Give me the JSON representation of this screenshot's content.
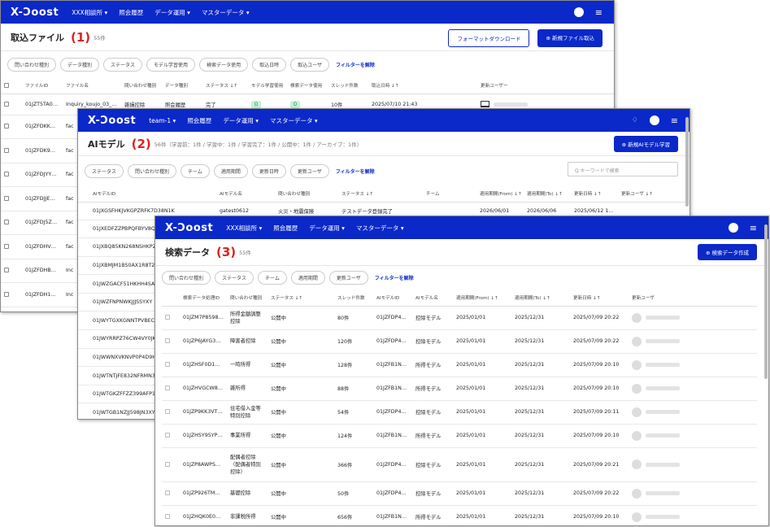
{
  "w1": {
    "logo": "X-Ɔoost",
    "nav": [
      "XXX相談所 ▾",
      "照会履歴",
      "データ運用 ▾",
      "マスターデータ ▾"
    ],
    "title": "取込ファイル",
    "num": "(1)",
    "count": "55件",
    "btn_dl": "フォーマットダウンロード",
    "btn_new": "⊕ 新規ファイル取込",
    "filters": [
      "問い合わせ種別",
      "データ種別",
      "ステータス",
      "モデル学習使用",
      "検索データ使用",
      "取込日時",
      "取込ユーザ"
    ],
    "clear": "フィルターを解除",
    "cols": [
      "",
      "ファイルID",
      "ファイル名",
      "問い合わせ種別",
      "データ種別",
      "ステータス ↓↑",
      "モデル学習使用",
      "検索データ使用",
      "スレッド件数",
      "取込日時 ↓↑",
      "更新ユーザー"
    ],
    "row": {
      "id": "01JZT5TA0…",
      "name": "Inquiry_koujo_03_…",
      "type": "雑損控除",
      "dtype": "照会履歴",
      "status": "完了",
      "m": "O",
      "s": "O",
      "cnt": "10件",
      "date": "2025/07/10 21:43"
    },
    "ids": [
      "01JZFDKK…",
      "01JZFDK9…",
      "01JZFDJYY…",
      "01JZFDJJE…",
      "01JZFDJ5Z…",
      "01JZFDHV…",
      "01JZFDHB…",
      "01JZFDH1…"
    ],
    "names": [
      "fac",
      "fac",
      "fac",
      "fac",
      "fac",
      "fac",
      "Inc",
      "Inc"
    ]
  },
  "w2": {
    "logo": "X-Ɔoost",
    "nav": [
      "team-1 ▾",
      "照会履歴",
      "データ運用 ▾",
      "マスターデータ ▾"
    ],
    "bell": "♢",
    "title": "AIモデル",
    "num": "(2)",
    "count": "56件（学習前：1件 / 学習中：1件 / 学習完了：1件 / 公開中：1件 / アーカイブ：1件）",
    "btn_new": "⊕ 新規AIモデル学習",
    "filters": [
      "ステータス",
      "問い合わせ種別",
      "チーム",
      "適用期間",
      "更新日時",
      "更新ユーザ"
    ],
    "clear": "フィルターを解除",
    "search": "Q キーワードで検索",
    "cols": [
      "AIモデルID",
      "AIモデル名",
      "問い合わせ種別",
      "ステータス ↓↑",
      "チーム",
      "適用期間(From) ↓↑",
      "適用期間(To) ↓↑",
      "更新日時 ↓↑",
      "更新ユーザ ↓↑"
    ],
    "row": {
      "id": "01JXGSFHKJVKGPZRFK7D38N1K",
      "name": "gatest0612",
      "type": "火災・地震保険",
      "status": "テストデータ登録完了",
      "from": "2026/06/01",
      "to": "2026/06/06",
      "upd": "2025/06/12 10:04"
    },
    "ids": [
      "01JXEDFZZPBPQFBYV8Q",
      "01JXBQ85KN268NSHKPZ",
      "01JXBMJM1BS0AX1R8T2",
      "01JWZGACF51HKHH4SAY",
      "01JWZFNPNWKJJJSSYXY",
      "01JWYTGXKGNNTPVBECD",
      "01JWYRRPZ76CW4VY0JK",
      "01JWWNXVKNVP0P4D9H",
      "01JWTNTJFE832NFRMN3",
      "01JWTGKZFFZZ399AFP1E",
      "01JWTGB1NZJJ598JN3XY"
    ]
  },
  "w3": {
    "logo": "X-Ɔoost",
    "nav": [
      "XXX相談所 ▾",
      "照会履歴",
      "データ運用 ▾",
      "マスターデータ ▾"
    ],
    "title": "検索データ",
    "num": "(3)",
    "count": "55件",
    "btn_new": "⊕ 検索データ作成",
    "filters": [
      "問い合わせ種別",
      "ステータス",
      "チーム",
      "適用期間",
      "更新ユーザ"
    ],
    "clear": "フィルターを解除",
    "cols": [
      "",
      "検索データ処理ID",
      "問い合わせ種別",
      "ステータス ↓↑",
      "スレッド件数",
      "AIモデルID",
      "AIモデル名",
      "適用期間(From) ↓↑",
      "適用期間(To) ↓↑",
      "更新日時 ↓↑",
      "更新ユーザ"
    ],
    "rows": [
      {
        "id": "01JZM7P8598…",
        "type": "所得金額調整控除",
        "status": "公開中",
        "cnt": "80件",
        "mid": "01JZFDP45…",
        "mname": "控除モデル",
        "from": "2025/01/01",
        "to": "2025/12/31",
        "upd": "2025/07/09 20:22"
      },
      {
        "id": "01JZP6JAYG3…",
        "type": "障害者控除",
        "status": "公開中",
        "cnt": "120件",
        "mid": "01JZFDP45…",
        "mname": "控除モデル",
        "from": "2025/01/01",
        "to": "2025/12/31",
        "upd": "2025/07/09 20:22"
      },
      {
        "id": "01JZHSF0D1…",
        "type": "一時所得",
        "status": "公開中",
        "cnt": "128件",
        "mid": "01JZFB1N…",
        "mname": "所得モデル",
        "from": "2025/01/01",
        "to": "2025/12/31",
        "upd": "2025/07/09 20:10"
      },
      {
        "id": "01JZHVGCW8…",
        "type": "雑所得",
        "status": "公開中",
        "cnt": "88件",
        "mid": "01JZFB1N…",
        "mname": "所得モデル",
        "from": "2025/01/01",
        "to": "2025/12/31",
        "upd": "2025/07/09 20:10"
      },
      {
        "id": "01JZP9KK3VT…",
        "type": "住宅借入金等特別控除",
        "status": "公開中",
        "cnt": "54件",
        "mid": "01JZFDP45…",
        "mname": "控除モデル",
        "from": "2025/01/01",
        "to": "2025/12/31",
        "upd": "2025/07/09 20:11"
      },
      {
        "id": "01JZHSY95YP…",
        "type": "事業所得",
        "status": "公開中",
        "cnt": "124件",
        "mid": "01JZFB1N…",
        "mname": "所得モデル",
        "from": "2025/01/01",
        "to": "2025/12/31",
        "upd": "2025/07/09 20:10"
      },
      {
        "id": "01JZP8AWPS…",
        "type": "配偶者控除（配偶者特別控除）",
        "status": "公開中",
        "cnt": "366件",
        "mid": "01JZFDP45…",
        "mname": "控除モデル",
        "from": "2025/01/01",
        "to": "2025/12/31",
        "upd": "2025/07/09 20:21"
      },
      {
        "id": "01JZP926TM…",
        "type": "基礎控除",
        "status": "公開中",
        "cnt": "50件",
        "mid": "01JZFDP45…",
        "mname": "控除モデル",
        "from": "2025/01/01",
        "to": "2025/12/31",
        "upd": "2025/07/09 20:22"
      },
      {
        "id": "01JZHQK0E0…",
        "type": "非課税所得",
        "status": "公開中",
        "cnt": "656件",
        "mid": "01JZFB1N…",
        "mname": "所得モデル",
        "from": "2025/01/01",
        "to": "2025/12/31",
        "upd": "2025/07/09 20:10"
      }
    ]
  }
}
